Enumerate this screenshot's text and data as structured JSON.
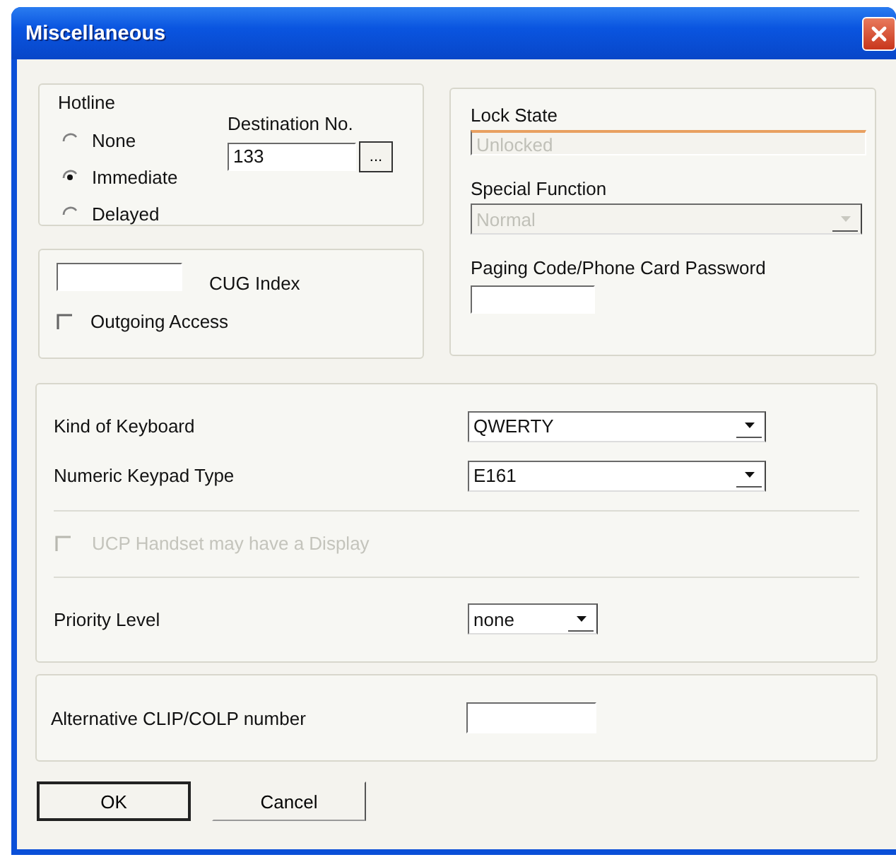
{
  "window": {
    "title": "Miscellaneous"
  },
  "hotline": {
    "label": "Hotline",
    "options": [
      {
        "label": "None",
        "selected": false
      },
      {
        "label": "Immediate",
        "selected": true
      },
      {
        "label": "Delayed",
        "selected": false
      }
    ],
    "destination": {
      "label": "Destination No.",
      "value": "133",
      "browse_button": "..."
    }
  },
  "cug": {
    "label": "CUG Index",
    "outgoing_access": {
      "label": "Outgoing Access",
      "checked": false
    }
  },
  "lock_state": {
    "label": "Lock State",
    "value": "Unlocked",
    "disabled": true
  },
  "special_function": {
    "label": "Special Function",
    "value": "Normal",
    "disabled": true
  },
  "paging_code": {
    "label": "Paging Code/Phone Card Password"
  },
  "keyboard": {
    "label": "Kind of Keyboard",
    "value": "QWERTY"
  },
  "keypad": {
    "label": "Numeric Keypad Type",
    "value": "E161"
  },
  "display_option": {
    "label": "UCP Handset may have a Display",
    "checked": false,
    "disabled": true
  },
  "priority": {
    "label": "Priority Level",
    "value": "none"
  },
  "clip": {
    "label": "Alternative CLIP/COLP number"
  },
  "buttons": [
    {
      "label": "OK",
      "default": true
    },
    {
      "label": "Cancel",
      "default": false
    }
  ]
}
